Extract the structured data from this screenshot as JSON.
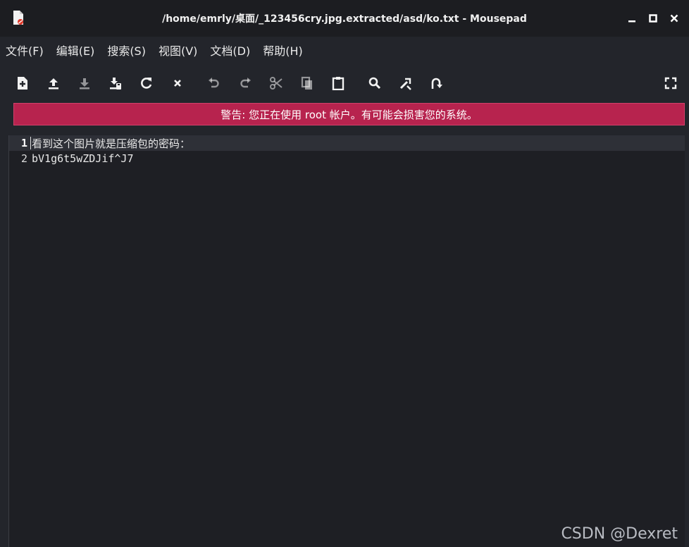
{
  "window": {
    "title": "/home/emrly/桌面/_123456cry.jpg.extracted/asd/ko.txt - Mousepad",
    "controls": {
      "minimize": "_",
      "maximize": "□",
      "close": "×"
    }
  },
  "menubar": {
    "items": [
      {
        "label": "文件(F)"
      },
      {
        "label": "编辑(E)"
      },
      {
        "label": "搜索(S)"
      },
      {
        "label": "视图(V)"
      },
      {
        "label": "文档(D)"
      },
      {
        "label": "帮助(H)"
      }
    ]
  },
  "toolbar": {
    "buttons": [
      {
        "icon": "new-document-icon"
      },
      {
        "icon": "open-file-icon"
      },
      {
        "icon": "save-icon"
      },
      {
        "icon": "save-as-icon"
      },
      {
        "icon": "reload-icon"
      },
      {
        "icon": "close-document-icon"
      },
      {
        "icon": "undo-icon"
      },
      {
        "icon": "redo-icon"
      },
      {
        "icon": "cut-icon"
      },
      {
        "icon": "copy-icon"
      },
      {
        "icon": "paste-icon"
      },
      {
        "icon": "find-icon"
      },
      {
        "icon": "find-replace-icon"
      },
      {
        "icon": "go-to-line-icon"
      },
      {
        "icon": "fullscreen-icon"
      }
    ]
  },
  "warning": {
    "text": "警告: 您正在使用 root 帐户。有可能会损害您的系统。",
    "background": "#b7234e"
  },
  "editor": {
    "lines": [
      {
        "number": "1",
        "text": "看到这个图片就是压缩包的密码："
      },
      {
        "number": "2",
        "text": "bV1g6t5wZDJif^J7"
      }
    ],
    "current_line": 1
  },
  "watermark": {
    "text": "CSDN @Dexret"
  }
}
